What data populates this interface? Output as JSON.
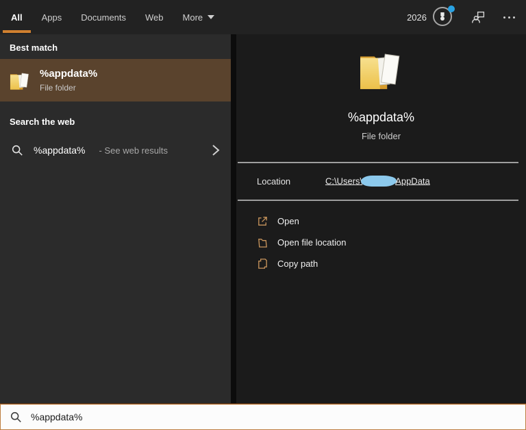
{
  "accent_color": "#d0802f",
  "topbar": {
    "tabs": [
      {
        "label": "All",
        "active": true
      },
      {
        "label": "Apps",
        "active": false
      },
      {
        "label": "Documents",
        "active": false
      },
      {
        "label": "Web",
        "active": false
      },
      {
        "label": "More",
        "active": false,
        "has_dropdown": true
      }
    ],
    "rewards_points": "2026",
    "rewards_badge_color": "#29a2e3",
    "icons": [
      "rewards-icon",
      "user-icon",
      "more-options-icon"
    ]
  },
  "left_panel": {
    "best_match": {
      "header": "Best match",
      "item": {
        "title": "%appdata%",
        "subtitle": "File folder",
        "icon": "folder-icon",
        "selected": true,
        "highlight_color": "#5a432d"
      }
    },
    "search_web": {
      "header": "Search the web",
      "item": {
        "query": "%appdata%",
        "suffix": "- See web results",
        "icon": "search-icon",
        "chevron": "chevron-right-icon"
      }
    }
  },
  "preview_panel": {
    "icon": "folder-icon",
    "title": "%appdata%",
    "subtitle": "File folder",
    "location_label": "Location",
    "location_link": {
      "prefix": "C:\\Users\\",
      "redacted": true,
      "redaction_color": "#8cc9ec",
      "suffix": "AppData"
    },
    "actions": [
      {
        "label": "Open",
        "icon": "open-icon"
      },
      {
        "label": "Open file location",
        "icon": "open-file-location-icon"
      },
      {
        "label": "Copy path",
        "icon": "copy-path-icon"
      }
    ],
    "action_icon_color": "#c9955c"
  },
  "search_bar": {
    "value": "%appdata%",
    "icon": "search-icon"
  }
}
